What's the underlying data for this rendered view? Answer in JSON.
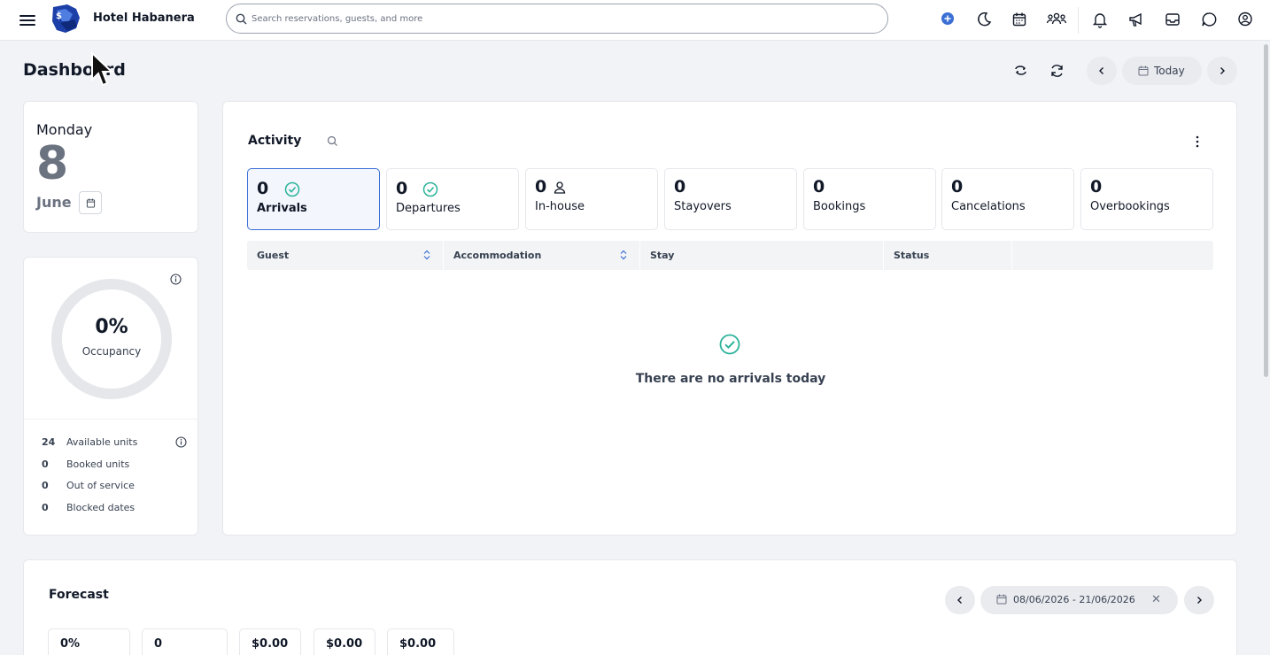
{
  "app": {
    "hotel_name": "Hotel Habanera",
    "search_placeholder": "Search reservations, guests, and more"
  },
  "topbar_icons": [
    "add-icon",
    "moon-icon",
    "calendar-icon",
    "users-icon",
    "bell-icon",
    "megaphone-icon",
    "inbox-icon",
    "chat-icon",
    "account-icon"
  ],
  "colors": {
    "accent": "#3b6fd4",
    "success": "#2bb39a",
    "page_bg": "#f1f3f6"
  },
  "page": {
    "title": "Dashboard",
    "today_label": "Today"
  },
  "date_card": {
    "weekday": "Monday",
    "day": "8",
    "month": "June"
  },
  "occupancy": {
    "percent": "0%",
    "label": "Occupancy",
    "percent_value": 0,
    "stats": [
      {
        "num": "24",
        "label": "Available units"
      },
      {
        "num": "0",
        "label": "Booked units"
      },
      {
        "num": "0",
        "label": "Out of service"
      },
      {
        "num": "0",
        "label": "Blocked dates"
      }
    ]
  },
  "activity": {
    "title": "Activity",
    "tiles": [
      {
        "count": "0",
        "label": "Arrivals",
        "icon": "check-circle-icon"
      },
      {
        "count": "0",
        "label": "Departures",
        "icon": "check-circle-icon"
      },
      {
        "count": "0",
        "label": "In-house",
        "icon": "person-icon"
      },
      {
        "count": "0",
        "label": "Stayovers"
      },
      {
        "count": "0",
        "label": "Bookings"
      },
      {
        "count": "0",
        "label": "Cancelations"
      },
      {
        "count": "0",
        "label": "Overbookings"
      }
    ],
    "columns": [
      "Guest",
      "Accommodation",
      "Stay",
      "Status"
    ],
    "empty_message": "There are no arrivals today"
  },
  "forecast": {
    "title": "Forecast",
    "date_range": "08/06/2026 - 21/06/2026",
    "values": [
      "0%",
      "0",
      "$0.00",
      "$0.00",
      "$0.00"
    ]
  }
}
